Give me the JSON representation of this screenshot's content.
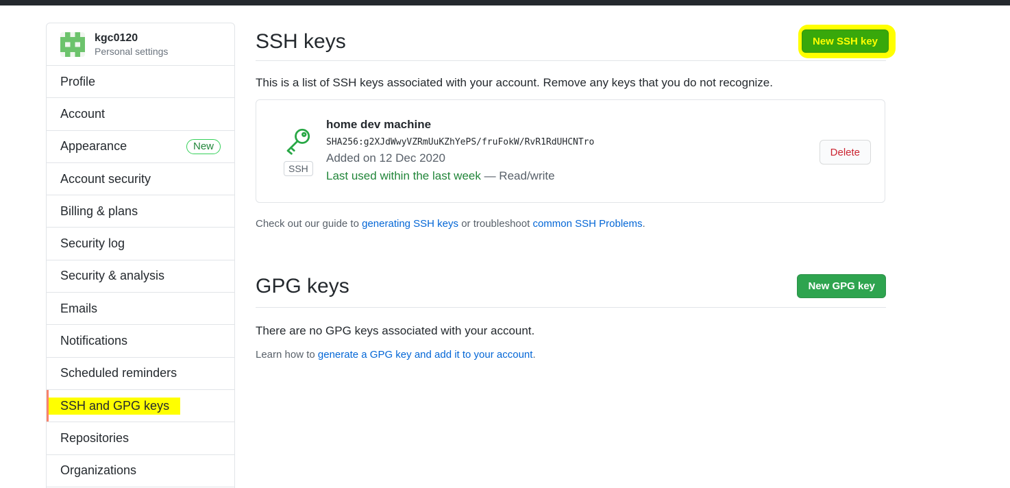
{
  "profile": {
    "username": "kgc0120",
    "subtitle": "Personal settings"
  },
  "sidebar": {
    "items": [
      {
        "label": "Profile"
      },
      {
        "label": "Account"
      },
      {
        "label": "Appearance",
        "badge": "New"
      },
      {
        "label": "Account security"
      },
      {
        "label": "Billing & plans"
      },
      {
        "label": "Security log"
      },
      {
        "label": "Security & analysis"
      },
      {
        "label": "Emails"
      },
      {
        "label": "Notifications"
      },
      {
        "label": "Scheduled reminders"
      },
      {
        "label": "SSH and GPG keys",
        "selected": true
      },
      {
        "label": "Repositories"
      },
      {
        "label": "Organizations"
      }
    ]
  },
  "ssh": {
    "title": "SSH keys",
    "new_button": "New SSH key",
    "intro": "This is a list of SSH keys associated with your account. Remove any keys that you do not recognize.",
    "key": {
      "name": "home dev machine",
      "tag": "SSH",
      "fingerprint": "SHA256:g2XJdWwyVZRmUuKZhYePS/fruFokW/RvR1RdUHCNTro",
      "added": "Added on 12 Dec 2020",
      "last_used": "Last used within the last week",
      "access": " — Read/write",
      "delete_label": "Delete"
    },
    "guide": {
      "prefix": "Check out our guide to ",
      "link1": "generating SSH keys",
      "middle": " or troubleshoot ",
      "link2": "common SSH Problems",
      "suffix": "."
    }
  },
  "gpg": {
    "title": "GPG keys",
    "new_button": "New GPG key",
    "empty": "There are no GPG keys associated with your account.",
    "learn_prefix": "Learn how to ",
    "learn_link": "generate a GPG key and add it to your account",
    "learn_suffix": "."
  },
  "colors": {
    "accent_green": "#2ea44f",
    "highlight": "#ffff00",
    "selected_marker": "#f9826c",
    "danger": "#cb2431",
    "link": "#0366d6"
  },
  "icons": {
    "key": "key-icon",
    "avatar": "identicon-avatar"
  }
}
